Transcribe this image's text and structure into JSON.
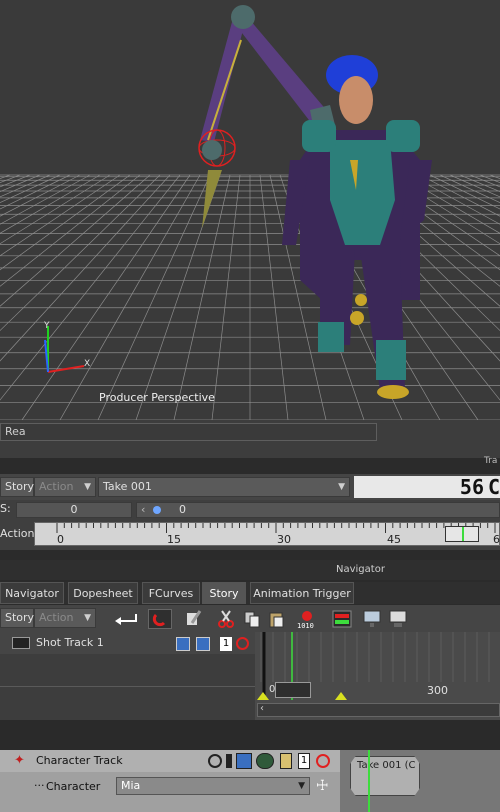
{
  "viewport": {
    "label": "Producer Perspective"
  },
  "status": {
    "value": "Rea",
    "right_label": "Tra"
  },
  "story_bar": {
    "mode": "Story",
    "submode": "Action",
    "take": "Take 001",
    "frame": "56",
    "frame_tail": "C"
  },
  "speed_row": {
    "label": "S:",
    "value1": "0",
    "value2": "0"
  },
  "action_ruler": {
    "label": "Action",
    "ticks": [
      "0",
      "15",
      "30",
      "45",
      "6"
    ]
  },
  "navigator_label": "Navigator",
  "tabs": [
    "Navigator",
    "Dopesheet",
    "FCurves",
    "Story",
    "Animation Trigger"
  ],
  "active_tab": "Story",
  "toolbar2": {
    "mode": "Story",
    "submode": "Action"
  },
  "shot_track": {
    "label": "Shot Track 1",
    "ruler_mark": "300",
    "num_badge": "1"
  },
  "character_track": {
    "label": "Character Track",
    "char_label": "Character",
    "char_value": "Mia",
    "num_badge": "1",
    "clip": "Take 001 (C"
  },
  "colors": {
    "accent_green": "#3ddc3d",
    "grid": "#8a8a8a",
    "viewport_bg": "#3a3a3a"
  }
}
